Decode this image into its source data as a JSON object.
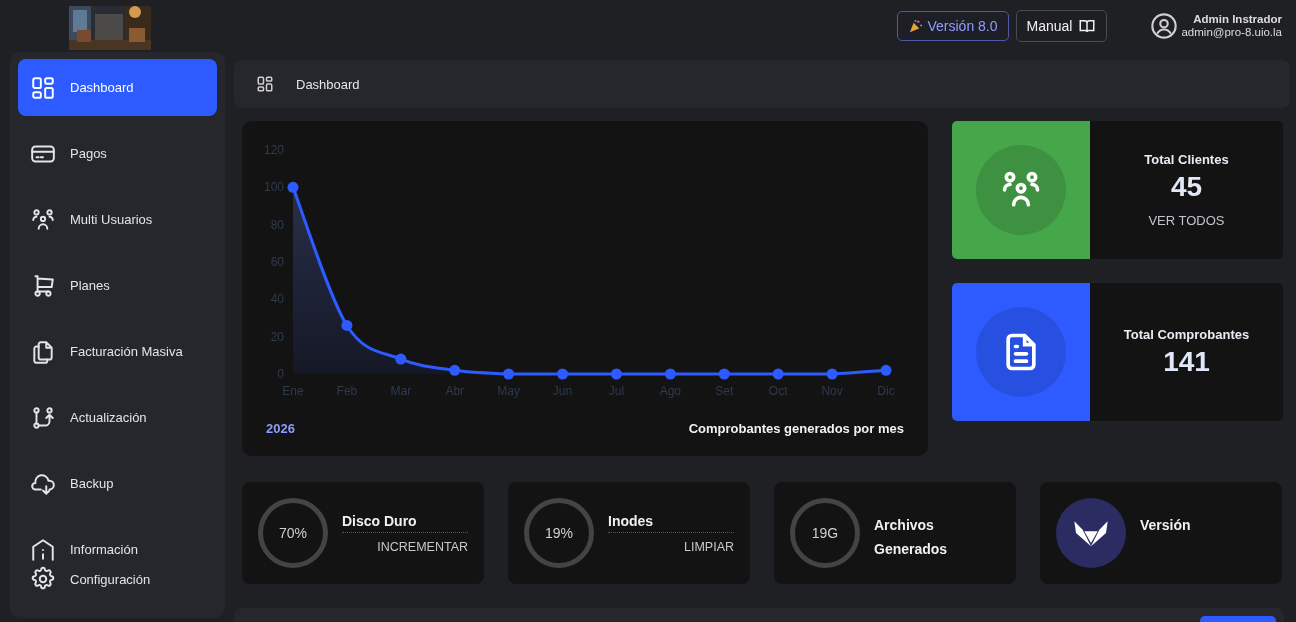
{
  "header": {
    "version_button": "Versión 8.0",
    "manual_button": "Manual",
    "user": {
      "name": "Admin Instrador",
      "email": "admin@pro-8.uio.la"
    }
  },
  "sidebar": {
    "items": [
      {
        "label": "Dashboard",
        "kind": "dashboard",
        "selected": true
      },
      {
        "label": "Pagos",
        "kind": "card",
        "selected": false
      },
      {
        "label": "Multi Usuarios",
        "kind": "users",
        "selected": false
      },
      {
        "label": "Planes",
        "kind": "cart",
        "selected": false
      },
      {
        "label": "Facturación Masiva",
        "kind": "copies",
        "selected": false
      },
      {
        "label": "Actualización",
        "kind": "branch",
        "selected": false
      },
      {
        "label": "Backup",
        "kind": "cloud",
        "selected": false
      },
      {
        "label": "Información",
        "kind": "info",
        "selected": false
      }
    ],
    "footer_item": {
      "label": "Configuración",
      "kind": "gear"
    }
  },
  "breadcrumb": {
    "label": "Dashboard"
  },
  "chart_card": {
    "chart_data": {
      "type": "line",
      "categories": [
        "Ene",
        "Feb",
        "Mar",
        "Abr",
        "May",
        "Jun",
        "Jul",
        "Ago",
        "Set",
        "Oct",
        "Nov",
        "Dic"
      ],
      "series": [
        {
          "color": "#2d5bff",
          "marker": true,
          "values": [
            100,
            26,
            8,
            2,
            0,
            0,
            0,
            0,
            0,
            0,
            0,
            2
          ]
        }
      ],
      "ylim": [
        0,
        120
      ],
      "yticks": [
        0,
        20,
        40,
        60,
        80,
        100,
        120
      ]
    },
    "year": "2026",
    "caption": "Comprobantes generados por mes"
  },
  "stats": [
    {
      "title": "Total Clientes",
      "value": "45",
      "link": "VER TODOS",
      "kind": "users",
      "color": "#46a64a"
    },
    {
      "title": "Total Comprobantes",
      "value": "141",
      "kind": "document",
      "color": "#2d5bff"
    }
  ],
  "metrics": [
    {
      "kind": "ring",
      "ring_text": "70%",
      "title": "Disco Duro",
      "action": "INCREMENTAR"
    },
    {
      "kind": "ring",
      "ring_text": "19%",
      "title": "Inodes",
      "action": "LIMPIAR"
    },
    {
      "kind": "ring",
      "ring_text": "19G",
      "title": "Archivos Generados"
    },
    {
      "kind": "logo",
      "title": "Versión"
    }
  ]
}
